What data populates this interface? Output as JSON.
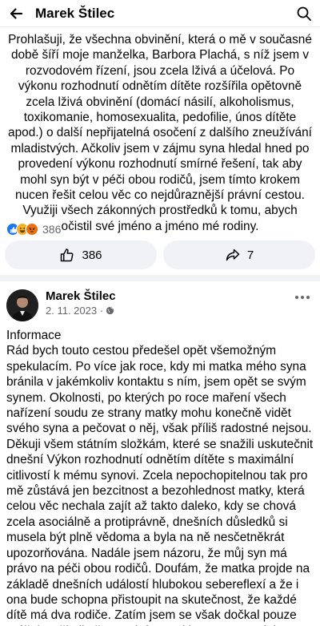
{
  "header": {
    "title": "Marek Štilec"
  },
  "post1": {
    "text": "Prohlašuji, že všechna obvinění, která o mě v současné době šíří moje manželka, Barbora Plachá, s níž jsem v rozvodovém řízení, jsou zcela lživá a účelová. Po výkonu rozhodnutí odnětím dítěte rozšířila opětovně zcela lživá obvinění (domácí násilí, alkoholismus, toxikomanie, homosexualita, pedofilie, únos dítěte apod.) o další nepřijatelná osočení z dalšího zneužívání mladistvých. Ačkoliv jsem v zájmu syna hledal hned po provedení výkonu rozhodnutí smírné řešení, tak aby mohl syn být v péči obou rodičů, jsem tímto krokem nucen řešit celou věc co nejdůraznější právní cestou. Využiji všech zákonných prostředků k tomu, abych očistil své jméno a jméno mé rodiny.",
    "reaction_count": "386",
    "like_button_count": "386",
    "share_button_count": "7"
  },
  "post2": {
    "author": "Marek Štilec",
    "date": "2. 11. 2023 ·",
    "text": "Informace\nRád bych touto cestou předešel opět všemožným spekulacím. Po více jak roce, kdy mi  matka mého syna bránila v jakémkoliv kontaktu s ním, jsem opět se svým synem. Okolnosti, po kterých po roce maření všech nařízení soudu ze strany matky mohu konečně vidět svého syna a pečovat o něj, však příliš radostné nejsou. Děkuji všem státním složkám, které se snažili uskutečnit dnešní Výkon rozhodnutí odnětím dítěte s maximální citlivostí k mému synovi. Zcela nepochopitelnou tak pro mě zůstává jen bezcitnost a bezohlednost matky, která celou věc nechala zajít až takto daleko, kdy se chová zcela asociálně a protiprávně, dnešních důsledků si musela být plně vědoma a byla na ně nesčetněkrát upozorňována. Nadále jsem názoru, že můj syn má právo na péči obou rodičů. Doufám, že matka projde na základě dnešních událostí hlubokou sebereflexí a že i ona bude schopna přistoupit na skutečnost, že každé dítě má dva rodiče. Zatím jsem se však dočkal pouze urážek. Děkuji , že tuto informaci berete pouze jako informaci a zdržíte se komentářů."
  },
  "icons": [
    "back-arrow-icon",
    "search-icon",
    "like-reaction-icon",
    "haha-reaction-icon",
    "angry-reaction-icon",
    "thumbs-up-icon",
    "share-icon",
    "globe-icon",
    "more-icon"
  ],
  "colors": {
    "accent": "#1877f2",
    "background": "#f0f2f5",
    "muted": "#65676b"
  }
}
